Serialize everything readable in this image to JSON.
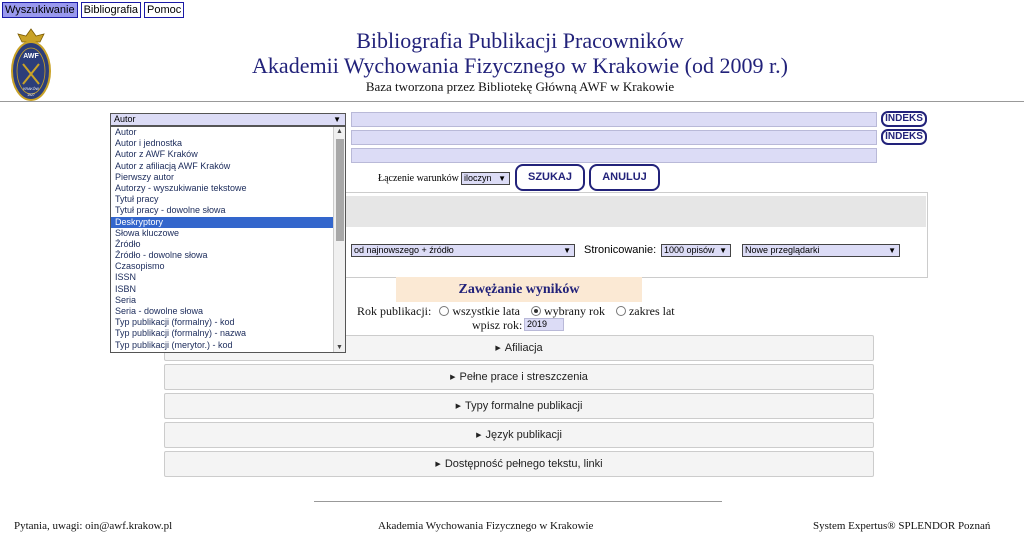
{
  "tabs": [
    {
      "label": "Wyszukiwanie"
    },
    {
      "label": "Bibliografia"
    },
    {
      "label": "Pomoc"
    }
  ],
  "header": {
    "title_line1": "Bibliografia Publikacji Pracowników",
    "title_line2": "Akademii Wychowania Fizycznego w Krakowie (od 2009 r.)",
    "subtitle": "Baza tworzona przez Bibliotekę Główną AWF w Krakowie"
  },
  "logo": {
    "text": "AWF",
    "sub": "KRAKÓW",
    "year": "1927"
  },
  "search": {
    "field_select": "Autor",
    "indeks_label": "INDEKS",
    "options": [
      "Autor",
      "Autor i jednostka",
      "Autor z AWF Kraków",
      "Autor z afiliacją AWF Kraków",
      "Pierwszy autor",
      "Autorzy - wyszukiwanie tekstowe",
      "Tytuł pracy",
      "Tytuł pracy - dowolne słowa",
      "Deskryptory",
      "Słowa kluczowe",
      "Źródło",
      "Źródło - dowolne słowa",
      "Czasopismo",
      "ISSN",
      "ISBN",
      "Seria",
      "Seria - dowolne słowa",
      "Typ publikacji (formalny) - kod",
      "Typ publikacji (formalny) - nazwa",
      "Typ publikacji (merytor.) - kod"
    ],
    "selected_option": "Deskryptory",
    "condition_label": "Łączenie warunków",
    "condition_value": "iloczyn",
    "search_button": "SZUKAJ",
    "cancel_button": "ANULUJ"
  },
  "options": {
    "sort_value": "od najnowszego + źródło",
    "paging_label": "Stronicowanie:",
    "paging_value": "1000 opisów",
    "view_value": "Nowe przeglądarki"
  },
  "narrowing": {
    "title": "Zawężanie wyników",
    "year_label": "Rok publikacji:",
    "radio_all": "wszystkie lata",
    "radio_selected": "wybrany rok",
    "radio_range": "zakres lat",
    "enter_year_label": "wpisz rok:",
    "year_value": "2019"
  },
  "sections": [
    {
      "label": "Afiliacja"
    },
    {
      "label": "Pełne prace i streszczenia"
    },
    {
      "label": "Typy formalne publikacji"
    },
    {
      "label": "Język publikacji"
    },
    {
      "label": "Dostępność pełnego tekstu, linki"
    }
  ],
  "footer": {
    "contact": "Pytania, uwagi: oin@awf.krakow.pl",
    "institution": "Akademia Wychowania Fizycznego w Krakowie",
    "system": "System Expertus® SPLENDOR Poznań"
  },
  "colors": {
    "accent": "#22227a",
    "input_bg": "#dcdcf6",
    "selected": "#3366cc"
  }
}
